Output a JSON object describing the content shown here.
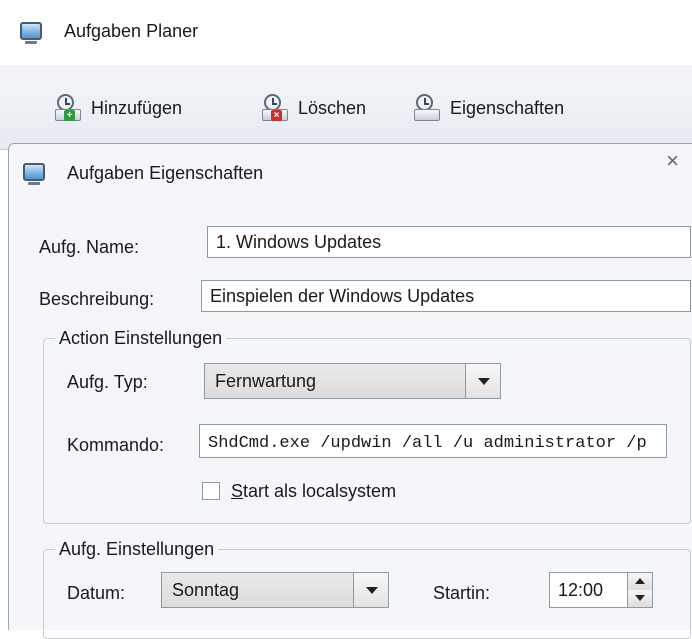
{
  "outer_window": {
    "title": "Aufgaben Planer",
    "icon": "window-icon"
  },
  "toolbar": {
    "add_label": "Hinzufügen",
    "delete_label": "Löschen",
    "properties_label": "Eigenschaften"
  },
  "dialog": {
    "title": "Aufgaben Eigenschaften",
    "close_glyph": "×",
    "name_label": "Aufg. Name:",
    "name_value": "1. Windows Updates",
    "description_label": "Beschreibung:",
    "description_value": "Einspielen der Windows Updates",
    "action_group": {
      "legend": "Action Einstellungen",
      "type_label": "Aufg. Typ:",
      "type_value": "Fernwartung",
      "command_label": "Kommando:",
      "command_value": "ShdCmd.exe /updwin /all /u administrator /p",
      "localsystem_underlined": "S",
      "localsystem_rest": "tart als localsystem",
      "localsystem_checked": false
    },
    "task_group": {
      "legend": "Aufg. Einstellungen",
      "date_label": "Datum:",
      "date_value": "Sonntag",
      "start_label": "Startin:",
      "start_value": "12:00"
    }
  }
}
